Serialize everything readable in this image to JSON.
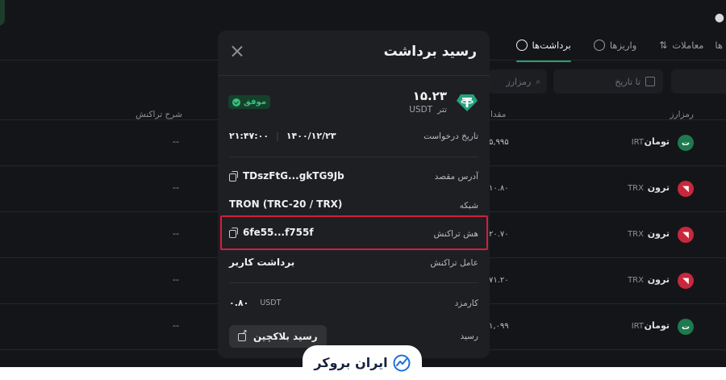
{
  "background": {
    "tabs": [
      {
        "label": "برداشت‌ها",
        "active": true
      },
      {
        "label": "واریزها",
        "active": false
      },
      {
        "label": "معاملات",
        "active": false
      },
      {
        "label": "ها",
        "active": false
      }
    ],
    "filters": {
      "date_to": "تا تاریخ",
      "coin": "رمزارز"
    },
    "table": {
      "headers": {
        "coin": "رمزارز",
        "amount": "مقدا",
        "desc": "شرح تراکنش"
      },
      "rows": [
        {
          "name": "تومان",
          "symbol": "IRT",
          "amount": "۵,۹۹۵",
          "desc": "--",
          "icon": "toman-icon",
          "color": "#1e7a4e"
        },
        {
          "name": "ترون",
          "symbol": "TRX",
          "amount": "۱۰.۸۰",
          "desc": "--",
          "icon": "tron-icon",
          "color": "#c8283c"
        },
        {
          "name": "ترون",
          "symbol": "TRX",
          "amount": "۲۰.۷۰",
          "desc": "--",
          "icon": "tron-icon",
          "color": "#c8283c"
        },
        {
          "name": "ترون",
          "symbol": "TRX",
          "amount": "۷۱.۲۰",
          "desc": "--",
          "icon": "tron-icon",
          "color": "#c8283c"
        },
        {
          "name": "تومان",
          "symbol": "IRT",
          "amount": "۱,۰۹۹",
          "desc": "--",
          "icon": "toman-icon",
          "color": "#1e7a4e"
        }
      ]
    }
  },
  "modal": {
    "title": "رسید برداشت",
    "amount": "۱۵.۲۳",
    "unit_fa": "تتر",
    "unit_symbol": "USDT",
    "status": "موفق",
    "rows": {
      "request_date_label": "تاریخ درخواست",
      "request_date": "۱۴۰۰/۱۲/۲۳",
      "request_time": "۲۱:۴۷:۰۰",
      "dest_label": "آدرس مقصد",
      "dest_value": "TDszFtG...gkTG9Jb",
      "network_label": "شبکه",
      "network_value": "TRON (TRC-20 / TRX)",
      "hash_label": "هش تراکنش",
      "hash_value": "6fe55...f755f",
      "agent_label": "عامل تراکنش",
      "agent_value": "برداشت کاربر",
      "fee_label": "کارمزد",
      "fee_value": "۰.۸۰",
      "fee_unit": "USDT",
      "receipt_label": "رسید",
      "receipt_button": "رسید بلاکچین"
    }
  },
  "brand": {
    "name": "ایران بروکر"
  },
  "colors": {
    "accent": "#27a36b",
    "highlight": "#d21f3c",
    "tether": "#26a17b"
  }
}
